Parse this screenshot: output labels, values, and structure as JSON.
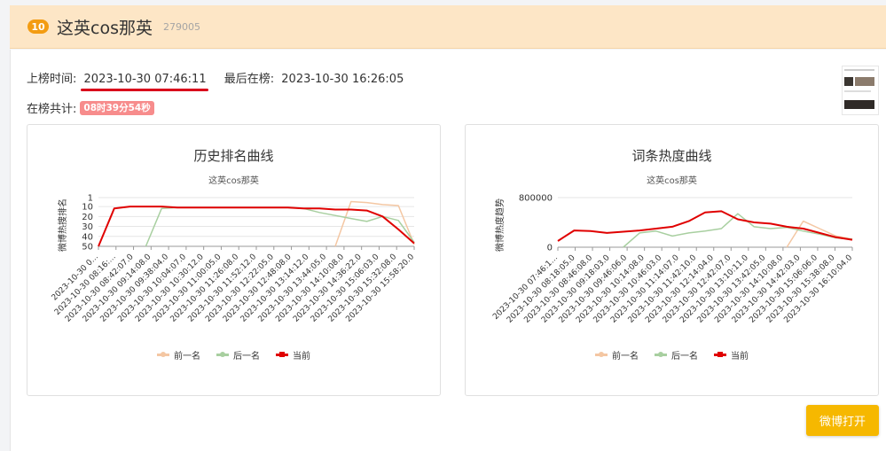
{
  "topic": {
    "rank": "10",
    "title": "这英cos那英",
    "id": "279005"
  },
  "info": {
    "onboard_label": "上榜时间:",
    "onboard_value": "2023-10-30 07:46:11",
    "last_label": "最后在榜:",
    "last_value": "2023-10-30 16:26:05",
    "total_label": "在榜共计:",
    "total_value": "08时39分54秒"
  },
  "button": {
    "weibo_open": "微博打开"
  },
  "colors": {
    "prev": "#f4c7a3",
    "next": "#a8cfa0",
    "current": "#e00000",
    "badge": "#f39c12",
    "button": "#f6b800"
  },
  "legend": {
    "prev": "前一名",
    "next": "后一名",
    "current": "当前"
  },
  "chart_data": [
    {
      "type": "line",
      "title": "历史排名曲线",
      "subtitle": "这英cos那英",
      "ylabel": "微博热搜排名",
      "y_inverted": true,
      "ylim": [
        1,
        50
      ],
      "yticks": [
        "1",
        "10",
        "20",
        "30",
        "40",
        "50"
      ],
      "x": [
        "2023-10-30 0…",
        "2023-10-30 08:16:…",
        "2023-10-30 08:42:07.0",
        "2023-10-30 09:14:08.0",
        "2023-10-30 09:38:04.0",
        "2023-10-30 10:04:07.0",
        "2023-10-30 10:30:12.0",
        "2023-10-30 11:00:05.0",
        "2023-10-30 11:26:08.0",
        "2023-10-30 11:52:12.0",
        "2023-10-30 12:22:05.0",
        "2023-10-30 12:48:08.0",
        "2023-10-30 13:14:12.0",
        "2023-10-30 13:44:05.0",
        "2023-10-30 14:10:08.0",
        "2023-10-30 14:36:22.0",
        "2023-10-30 15:06:03.0",
        "2023-10-30 15:32:08.0",
        "2023-10-30 15:58:20.0"
      ],
      "series": [
        {
          "name": "前一名",
          "values": [
            null,
            null,
            null,
            null,
            null,
            null,
            null,
            null,
            null,
            null,
            null,
            null,
            null,
            null,
            null,
            50,
            5,
            6,
            8,
            9,
            48
          ]
        },
        {
          "name": "后一名",
          "values": [
            null,
            null,
            null,
            50,
            12,
            11,
            11,
            11,
            11,
            11,
            11,
            11,
            11,
            12,
            16,
            19,
            22,
            25,
            20,
            24,
            46
          ]
        },
        {
          "name": "当前",
          "values": [
            50,
            12,
            10,
            10,
            10,
            11,
            11,
            11,
            11,
            11,
            11,
            11,
            11,
            12,
            12,
            13,
            13,
            14,
            20,
            33,
            47
          ]
        }
      ]
    },
    {
      "type": "line",
      "title": "词条热度曲线",
      "subtitle": "这英cos那英",
      "ylabel": "微博热度趋势",
      "ylim": [
        0,
        800000
      ],
      "yticks": [
        "0",
        "800000"
      ],
      "x": [
        "2023-10-30 07:46:1…",
        "2023-10-30 08:18:05.0",
        "2023-10-30 08:46:08.0",
        "2023-10-30 09:18:03.0",
        "2023-10-30 09:46:06.0",
        "2023-10-30 10:14:08.0",
        "2023-10-30 10:46:03.0",
        "2023-10-30 11:14:07.0",
        "2023-10-30 11:42:10.0",
        "2023-10-30 12:14:04.0",
        "2023-10-30 12:42:07.0",
        "2023-10-30 13:10:11.0",
        "2023-10-30 13:42:05.0",
        "2023-10-30 14:10:08.0",
        "2023-10-30 14:42:03.0",
        "2023-10-30 15:06:06.0",
        "2023-10-30 15:38:08.0",
        "2023-10-30 16:10:04.0"
      ],
      "series": [
        {
          "name": "前一名",
          "values": [
            null,
            null,
            null,
            null,
            null,
            null,
            null,
            null,
            null,
            null,
            null,
            null,
            null,
            null,
            0,
            420000,
            300000,
            180000,
            130000
          ]
        },
        {
          "name": "后一名",
          "values": [
            null,
            null,
            null,
            null,
            0,
            230000,
            260000,
            180000,
            230000,
            260000,
            300000,
            540000,
            330000,
            300000,
            320000,
            260000,
            210000,
            150000,
            130000
          ]
        },
        {
          "name": "当前",
          "values": [
            100000,
            270000,
            260000,
            230000,
            250000,
            270000,
            300000,
            330000,
            420000,
            560000,
            580000,
            450000,
            400000,
            380000,
            330000,
            300000,
            230000,
            160000,
            120000
          ]
        }
      ]
    }
  ]
}
